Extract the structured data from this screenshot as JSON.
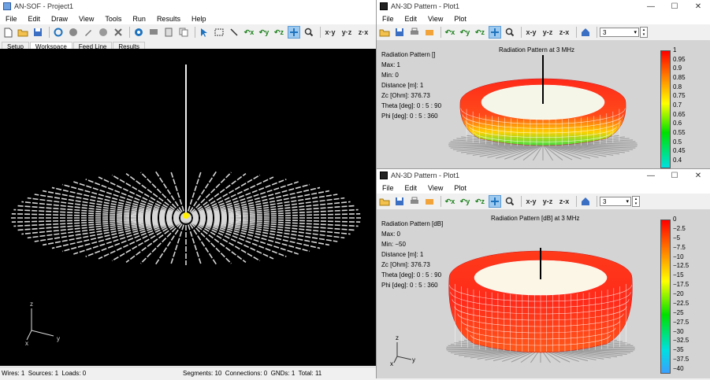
{
  "main": {
    "title": "AN-SOF - Project1",
    "menu": [
      "File",
      "Edit",
      "Draw",
      "View",
      "Tools",
      "Run",
      "Results",
      "Help"
    ],
    "tabs": [
      "Setup",
      "Workspace",
      "Feed Line",
      "Results"
    ],
    "status_left": "Wires: 1  Sources: 1  Loads: 0",
    "status_right": "Segments: 10  Connections: 0  GNDs: 1  Total: 11",
    "axis": {
      "x": "x",
      "y": "y",
      "z": "z"
    }
  },
  "plot1": {
    "title": "AN-3D Pattern - Plot1",
    "menu": [
      "File",
      "Edit",
      "View",
      "Plot"
    ],
    "view_buttons": [
      "x-y",
      "y-z",
      "z-x"
    ],
    "combo_value": "3",
    "chart_title": "Radiation Pattern at 3 MHz",
    "info": [
      "Radiation Pattern []",
      "Max: 1",
      "Min: 0",
      "Distance [m]: 1",
      "Zc [Ohm]: 376.73",
      "Theta [deg]: 0 : 5 : 90",
      "Phi [deg]: 0 : 5 : 360"
    ],
    "scale": [
      "1",
      "0.95",
      "0.9",
      "0.85",
      "0.8",
      "0.75",
      "0.7",
      "0.65",
      "0.6",
      "0.55",
      "0.5",
      "0.45",
      "0.4"
    ]
  },
  "plot2": {
    "title": "AN-3D Pattern - Plot1",
    "menu": [
      "File",
      "Edit",
      "View",
      "Plot"
    ],
    "view_buttons": [
      "x-y",
      "y-z",
      "z-x"
    ],
    "combo_value": "3",
    "chart_title": "Radiation Pattern [dB] at 3 MHz",
    "info": [
      "Radiation Pattern [dB]",
      "Max: 0",
      "Min: −50",
      "Distance [m]: 1",
      "Zc [Ohm]: 376.73",
      "Theta [deg]: 0 : 5 : 90",
      "Phi [deg]: 0 : 5 : 360"
    ],
    "scale": [
      "0",
      "−2.5",
      "−5",
      "−7.5",
      "−10",
      "−12.5",
      "−15",
      "−17.5",
      "−20",
      "−22.5",
      "−25",
      "−27.5",
      "−30",
      "−32.5",
      "−35",
      "−37.5",
      "−40"
    ],
    "axis": {
      "x": "x",
      "y": "y",
      "z": "z"
    }
  },
  "colors": {
    "accent": "#1e73be",
    "viewport": "#000000",
    "pattern_bg": "#d4d4d4"
  }
}
